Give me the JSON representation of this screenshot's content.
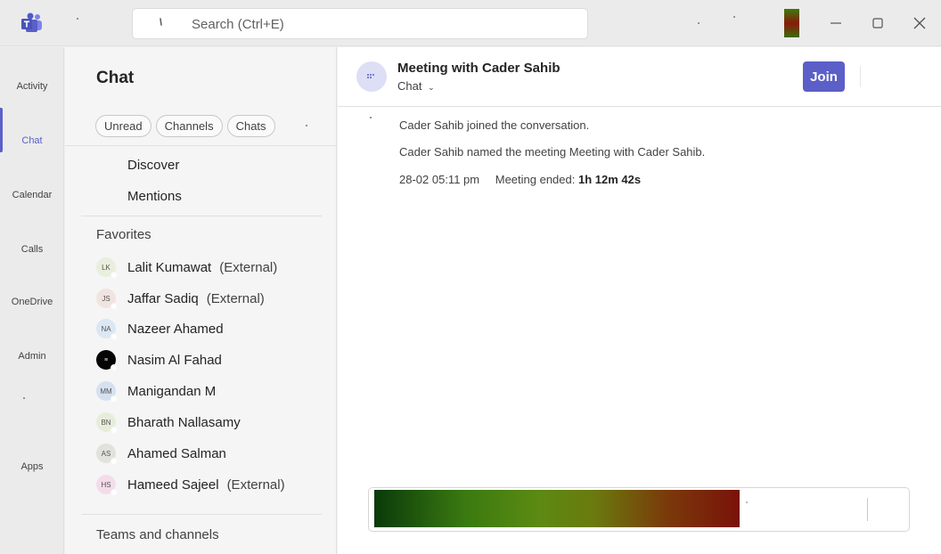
{
  "titlebar": {
    "search_placeholder": "Search (Ctrl+E)"
  },
  "rail": {
    "items": [
      {
        "label": "Activity"
      },
      {
        "label": "Chat"
      },
      {
        "label": "Calendar"
      },
      {
        "label": "Calls"
      },
      {
        "label": "OneDrive"
      },
      {
        "label": "Admin"
      },
      {
        "label": "Apps"
      }
    ],
    "active_index": 1
  },
  "chat_pane": {
    "title": "Chat",
    "filters": [
      "Unread",
      "Channels",
      "Chats"
    ],
    "links": [
      "Discover",
      "Mentions"
    ],
    "favorites_title": "Favorites",
    "contacts": [
      {
        "initials": "LK",
        "name": "Lalit Kumawat",
        "tag": "(External)"
      },
      {
        "initials": "JS",
        "name": "Jaffar Sadiq",
        "tag": "(External)"
      },
      {
        "initials": "NA",
        "name": "Nazeer Ahamed",
        "tag": ""
      },
      {
        "initials": "",
        "name": "Nasim Al Fahad",
        "tag": ""
      },
      {
        "initials": "MM",
        "name": "Manigandan M",
        "tag": ""
      },
      {
        "initials": "BN",
        "name": "Bharath Nallasamy",
        "tag": ""
      },
      {
        "initials": "AS",
        "name": "Ahamed Salman",
        "tag": ""
      },
      {
        "initials": "HS",
        "name": "Hameed Sajeel",
        "tag": "(External)"
      }
    ],
    "teams_title": "Teams and channels"
  },
  "conversation": {
    "title": "Meeting with Cader Sahib",
    "subtitle": "Chat",
    "join_label": "Join",
    "events": [
      {
        "text": "Cader Sahib joined the conversation."
      },
      {
        "text": "Cader Sahib named the meeting Meeting with Cader Sahib."
      }
    ],
    "meeting_ended": {
      "time": "28-02 05:11 pm",
      "label": "Meeting ended:",
      "duration": "1h 12m 42s"
    }
  },
  "colors": {
    "accent": "#5b5fc7"
  }
}
